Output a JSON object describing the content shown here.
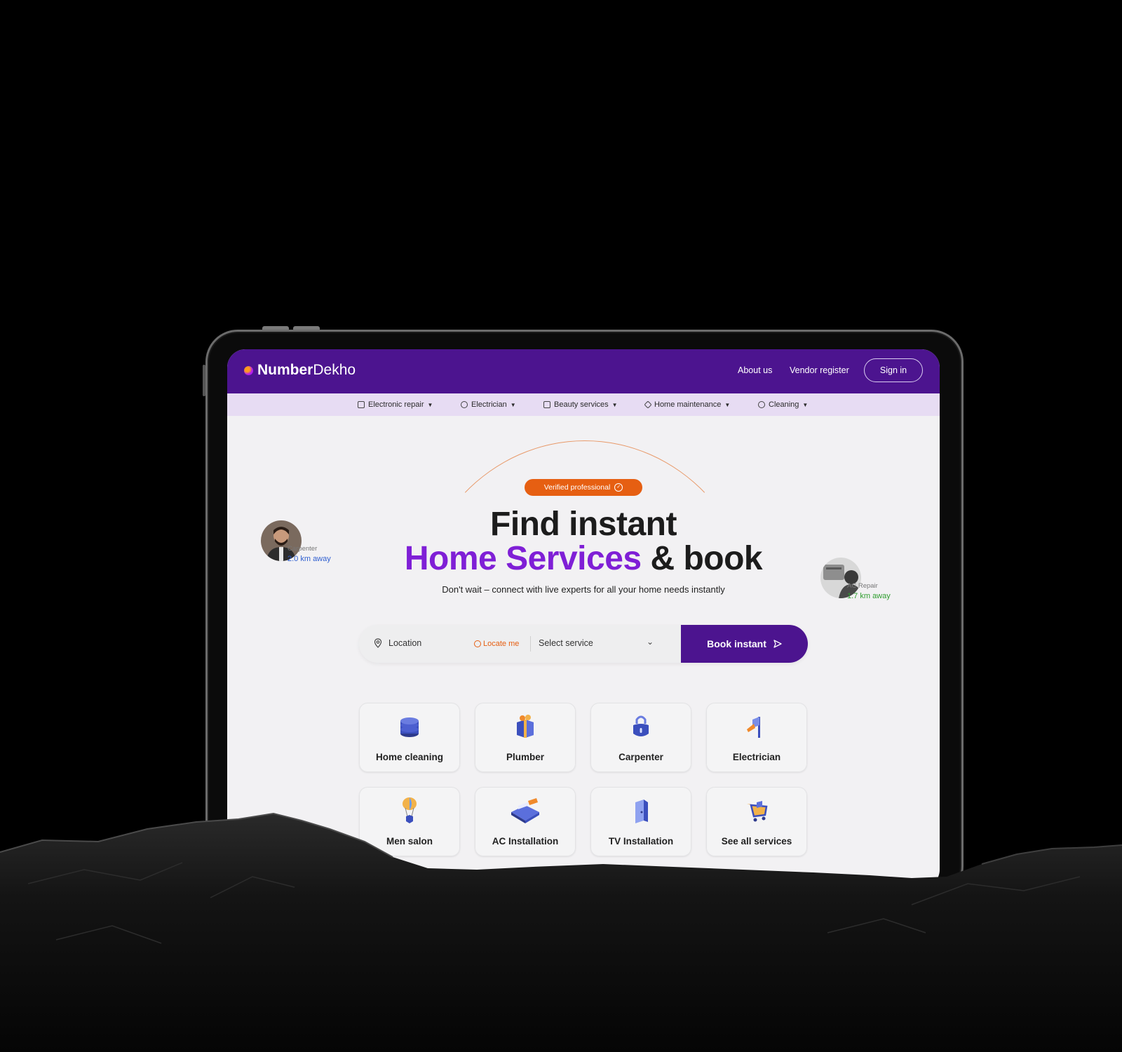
{
  "brand": {
    "bold": "Number",
    "light": "Dekho"
  },
  "header": {
    "nav": [
      {
        "label": "About us"
      },
      {
        "label": "Vendor register"
      }
    ],
    "signin_label": "Sign in"
  },
  "categories": [
    {
      "label": "Electronic repair",
      "icon": "tv-icon"
    },
    {
      "label": "Electrician",
      "icon": "bulb-icon"
    },
    {
      "label": "Beauty services",
      "icon": "bag-icon"
    },
    {
      "label": "Home maintenance",
      "icon": "wrench-icon"
    },
    {
      "label": "Cleaning",
      "icon": "sparkle-icon"
    }
  ],
  "hero": {
    "badge": "Verified professional",
    "title_line1": "Find instant",
    "title_accent": "Home Services",
    "title_rest": "& book",
    "subtitle": "Don't wait – connect with live experts for all your home needs instantly"
  },
  "nearby": [
    {
      "role": "Carpenter",
      "distance": "2.0 km away",
      "color": "#2f5fd0"
    },
    {
      "role": "AC Repair",
      "distance": "1.7 km away",
      "color": "#2f9e2f"
    }
  ],
  "search": {
    "location_placeholder": "Location",
    "locate_label": "Locate me",
    "service_placeholder": "Select service",
    "book_label": "Book instant"
  },
  "services": [
    {
      "label": "Home cleaning",
      "icon": "coins-icon"
    },
    {
      "label": "Plumber",
      "icon": "gift-icon"
    },
    {
      "label": "Carpenter",
      "icon": "lock-icon"
    },
    {
      "label": "Electrician",
      "icon": "pin-icon"
    },
    {
      "label": "Men salon",
      "icon": "balloon-icon"
    },
    {
      "label": "AC Installation",
      "icon": "machine-icon"
    },
    {
      "label": "TV Installation",
      "icon": "door-icon"
    },
    {
      "label": "See all services",
      "icon": "cart-icon"
    }
  ],
  "colors": {
    "brand": "#4c148f",
    "accent": "#7f1fd6",
    "orange": "#e65f12"
  }
}
